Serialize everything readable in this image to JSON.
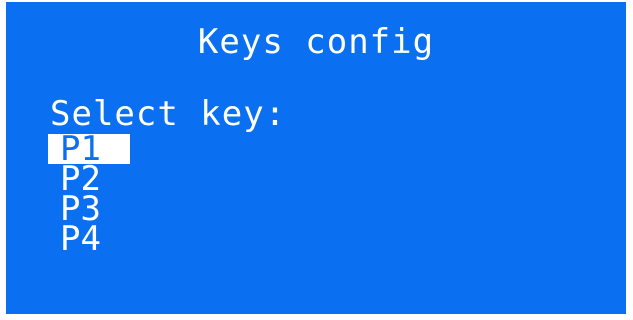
{
  "screen": {
    "title": "Keys config",
    "prompt": "Select key:",
    "keys": [
      {
        "label": "P1",
        "selected": true
      },
      {
        "label": "P2",
        "selected": false
      },
      {
        "label": "P3",
        "selected": false
      },
      {
        "label": "P4",
        "selected": false
      }
    ]
  },
  "colors": {
    "background": "#0a6ff0",
    "text": "#ffffff",
    "highlight_bg": "#ffffff",
    "highlight_text": "#0a6ff0"
  }
}
